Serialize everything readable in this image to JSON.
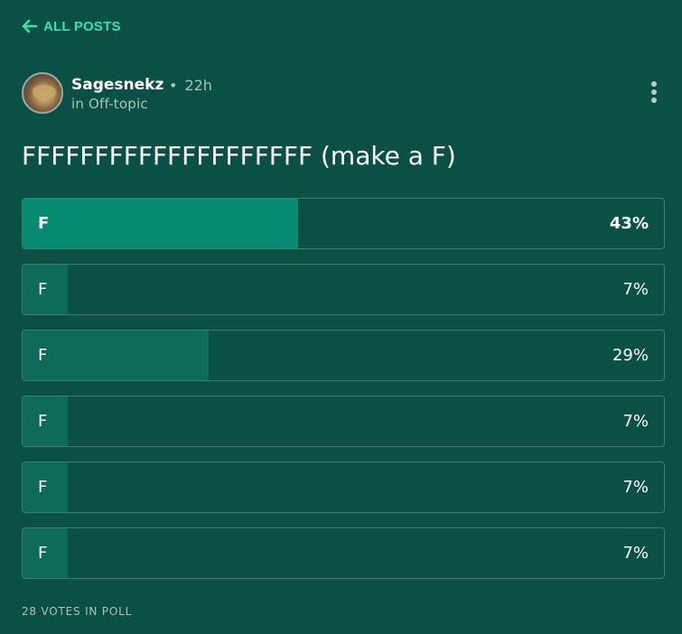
{
  "header": {
    "back_label": "ALL POSTS",
    "back_icon": "arrow-left-icon",
    "accent_color": "#3ee0ad"
  },
  "post": {
    "author": "Sagesnekz",
    "separator": "•",
    "time_ago": "22h",
    "community": "in Off-topic",
    "menu_icon": "kebab-menu-icon",
    "title": "FFFFFFFFFFFFFFFFFFFF (make a F)"
  },
  "poll": {
    "options": [
      {
        "label": "F",
        "percent_text": "43%",
        "percent": 43,
        "leading": true
      },
      {
        "label": "F",
        "percent_text": "7%",
        "percent": 7,
        "leading": false
      },
      {
        "label": "F",
        "percent_text": "29%",
        "percent": 29,
        "leading": false
      },
      {
        "label": "F",
        "percent_text": "7%",
        "percent": 7,
        "leading": false
      },
      {
        "label": "F",
        "percent_text": "7%",
        "percent": 7,
        "leading": false
      },
      {
        "label": "F",
        "percent_text": "7%",
        "percent": 7,
        "leading": false
      }
    ],
    "votes_text": "28 VOTES IN POLL"
  },
  "colors": {
    "background": "#0a5045",
    "fill": "#0e6a59",
    "fill_leading": "#078a72",
    "border": "#3d7d72",
    "muted_text": "#a7c4bd"
  }
}
